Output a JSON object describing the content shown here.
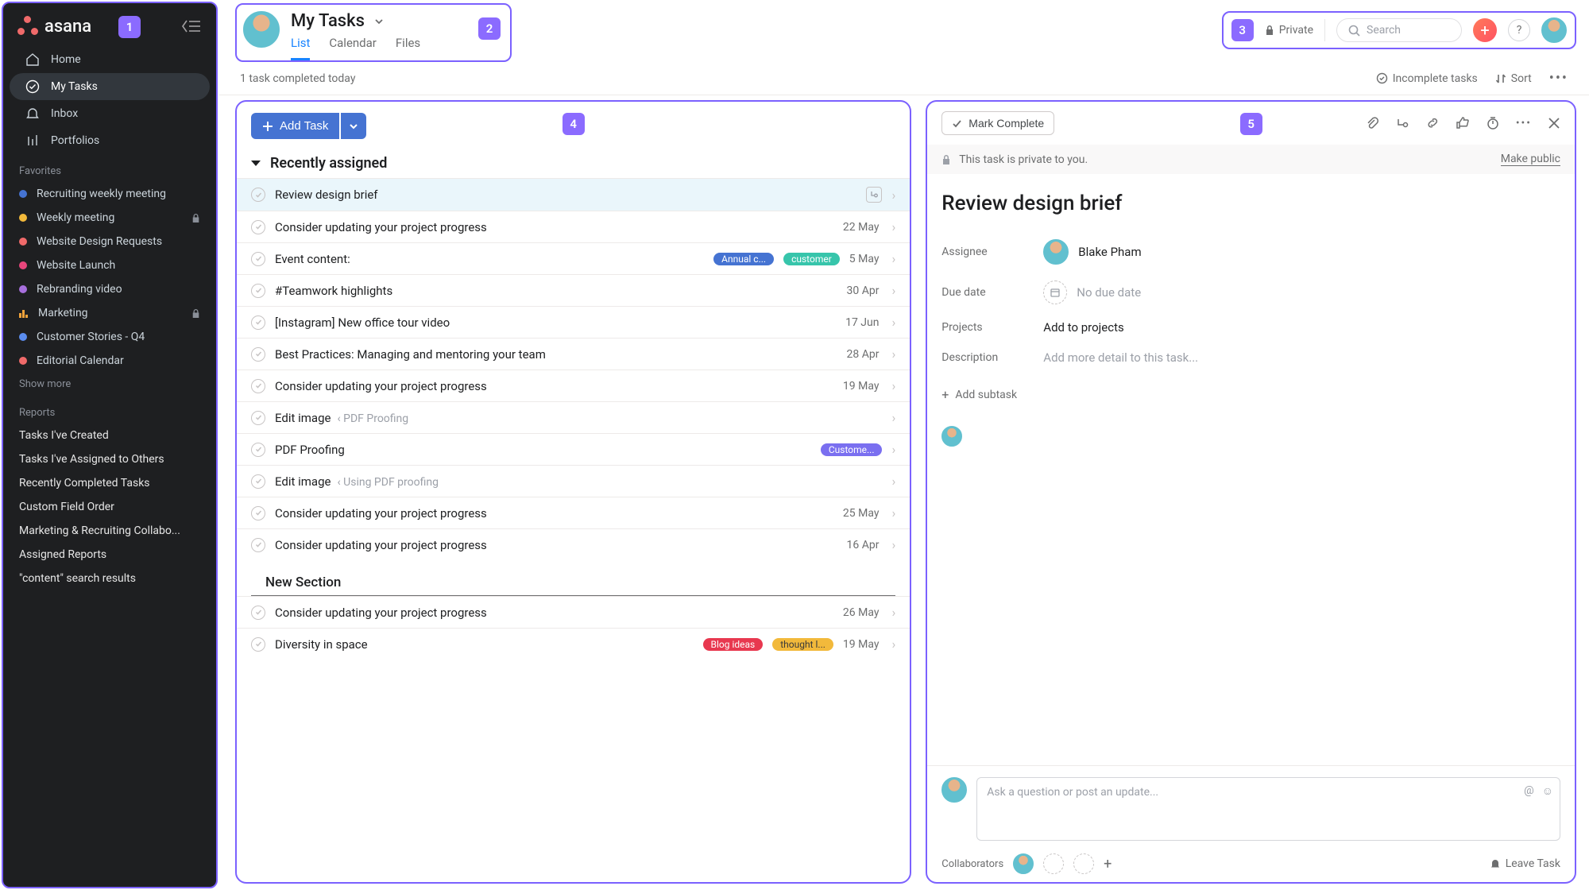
{
  "brand": "asana",
  "annotations": {
    "sidebar": "1",
    "header": "2",
    "topright": "3",
    "list": "4",
    "detail": "5"
  },
  "sidebar": {
    "nav": [
      {
        "label": "Home"
      },
      {
        "label": "My Tasks"
      },
      {
        "label": "Inbox"
      },
      {
        "label": "Portfolios"
      }
    ],
    "favorites_label": "Favorites",
    "favorites": [
      {
        "label": "Recruiting weekly meeting",
        "color": "#4573d2"
      },
      {
        "label": "Weekly meeting",
        "color": "#f2b93b",
        "locked": true
      },
      {
        "label": "Website Design Requests",
        "color": "#f06a6a"
      },
      {
        "label": "Website Launch",
        "color": "#e8467c"
      },
      {
        "label": "Rebranding video",
        "color": "#a76fdd"
      },
      {
        "label": "Marketing",
        "bars": true,
        "locked": true
      },
      {
        "label": "Customer Stories - Q4",
        "color": "#5b8def"
      },
      {
        "label": "Editorial Calendar",
        "color": "#f06a6a"
      }
    ],
    "show_more": "Show more",
    "reports_label": "Reports",
    "reports": [
      "Tasks I've Created",
      "Tasks I've Assigned to Others",
      "Recently Completed Tasks",
      "Custom Field Order",
      "Marketing & Recruiting Collabo...",
      "Assigned Reports",
      "\"content\" search results"
    ]
  },
  "header": {
    "title": "My Tasks",
    "tabs": [
      "List",
      "Calendar",
      "Files"
    ]
  },
  "topright": {
    "privacy": "Private",
    "search_placeholder": "Search"
  },
  "subbar": {
    "status": "1 task completed today",
    "filter": "Incomplete tasks",
    "sort": "Sort"
  },
  "list": {
    "add_label": "Add Task",
    "section": "Recently assigned",
    "tasks": [
      {
        "name": "Review design brief",
        "selected": true,
        "subtasks": true
      },
      {
        "name": "Consider updating your project progress",
        "date": "22 May"
      },
      {
        "name": "Event content:",
        "pills": [
          {
            "t": "Annual c...",
            "c": "blue"
          },
          {
            "t": "customer",
            "c": "teal"
          }
        ],
        "date": "5 May"
      },
      {
        "name": "#Teamwork highlights",
        "date": "30 Apr"
      },
      {
        "name": "[Instagram] New office tour video",
        "date": "17 Jun"
      },
      {
        "name": "Best Practices: Managing and mentoring your team",
        "date": "28 Apr"
      },
      {
        "name": "Consider updating your project progress",
        "date": "19 May"
      },
      {
        "name": "Edit image",
        "sub": "‹ PDF Proofing"
      },
      {
        "name": "PDF Proofing",
        "pills": [
          {
            "t": "Custome...",
            "c": "purple"
          }
        ]
      },
      {
        "name": "Edit image",
        "sub": "‹ Using PDF proofing"
      },
      {
        "name": "Consider updating your project progress",
        "date": "25 May"
      },
      {
        "name": "Consider updating your project progress",
        "date": "16 Apr"
      }
    ],
    "new_section": "New Section",
    "tasks2": [
      {
        "name": "Consider updating your project progress",
        "date": "26 May"
      },
      {
        "name": "Diversity in space",
        "pills": [
          {
            "t": "Blog ideas",
            "c": "red"
          },
          {
            "t": "thought l...",
            "c": "yel"
          }
        ],
        "date": "19 May"
      }
    ]
  },
  "detail": {
    "mark": "Mark Complete",
    "privacy_msg": "This task is private to you.",
    "make_public": "Make public",
    "title": "Review design brief",
    "assignee_label": "Assignee",
    "assignee": "Blake Pham",
    "due_label": "Due date",
    "due_placeholder": "No due date",
    "projects_label": "Projects",
    "projects_placeholder": "Add to projects",
    "desc_label": "Description",
    "desc_placeholder": "Add more detail to this task...",
    "add_subtask": "Add subtask",
    "comment_placeholder": "Ask a question or post an update...",
    "collaborators": "Collaborators",
    "leave": "Leave Task"
  }
}
